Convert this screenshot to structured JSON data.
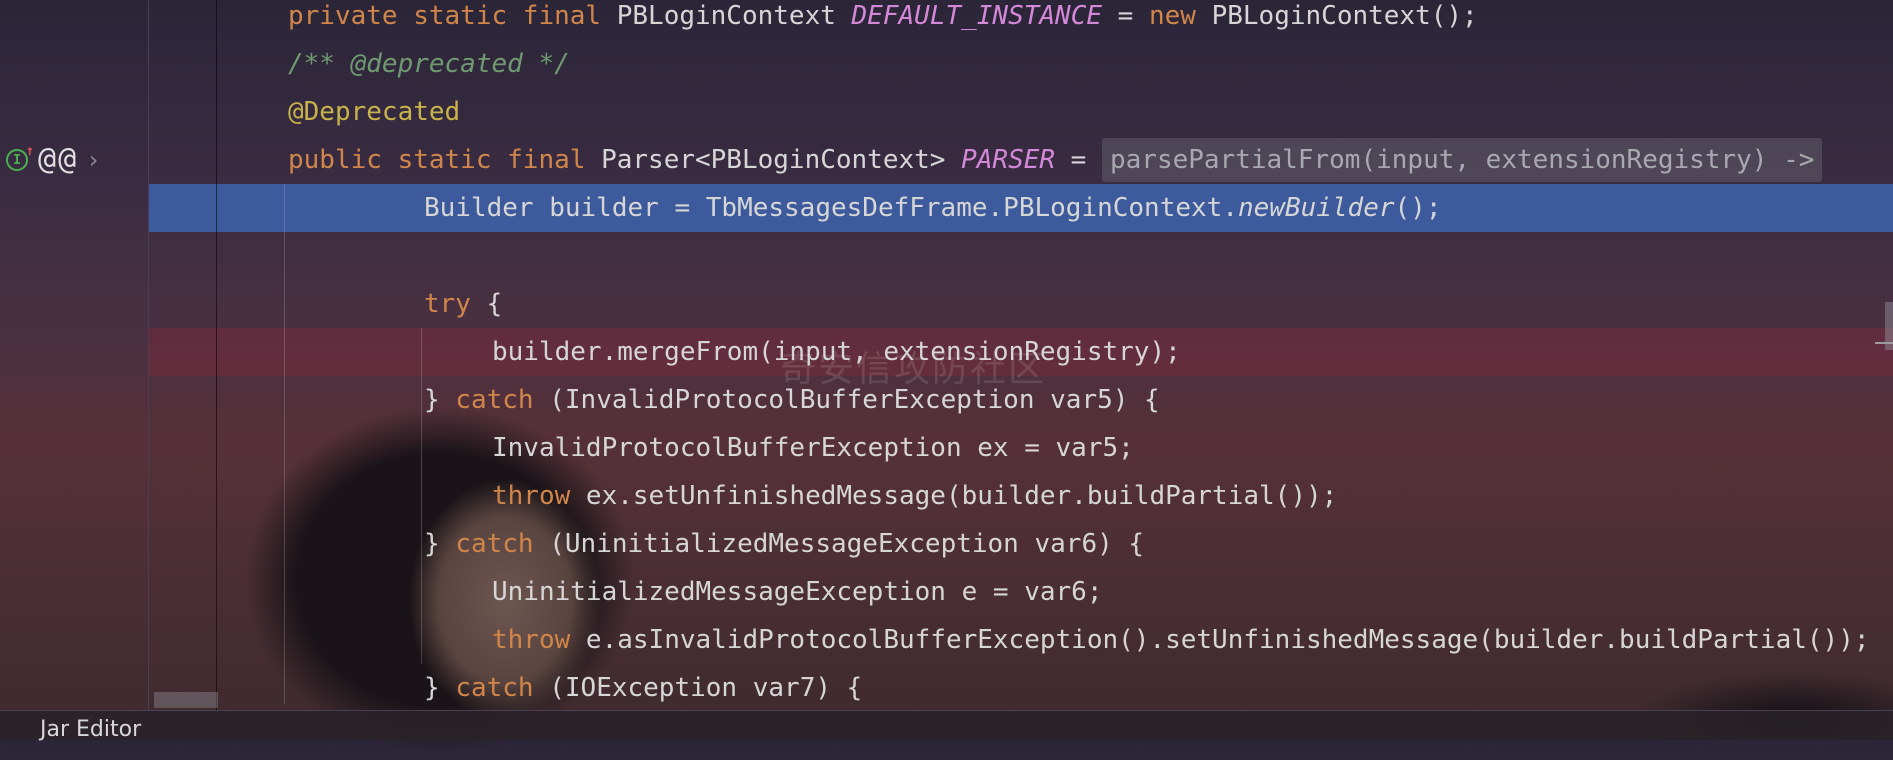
{
  "editor": {
    "lines": [
      {
        "segments": [
          {
            "t": "private static final ",
            "c": "kw"
          },
          {
            "t": "PBLoginContext ",
            "c": ""
          },
          {
            "t": "DEFAULT_INSTANCE",
            "c": "fn-italic"
          },
          {
            "t": " = ",
            "c": ""
          },
          {
            "t": "new ",
            "c": "kw"
          },
          {
            "t": "PBLoginContext();",
            "c": ""
          }
        ]
      },
      {
        "segments": [
          {
            "t": "/** @deprecated */",
            "c": "comment"
          }
        ]
      },
      {
        "segments": [
          {
            "t": "@Deprecated",
            "c": "anno"
          }
        ]
      },
      {
        "segments": [
          {
            "t": "public static final ",
            "c": "kw"
          },
          {
            "t": "Parser<PBLoginContext> ",
            "c": ""
          },
          {
            "t": "PARSER",
            "c": "fn-italic"
          },
          {
            "t": " = ",
            "c": ""
          }
        ],
        "hint": "parsePartialFrom(input, extensionRegistry) ->"
      },
      {
        "segments": [
          {
            "t": "Builder builder = TbMessagesDefFrame.PBLoginContext.",
            "c": ""
          },
          {
            "t": "newBuilder",
            "c": "ital"
          },
          {
            "t": "();",
            "c": ""
          }
        ]
      },
      {
        "segments": []
      },
      {
        "segments": [
          {
            "t": "try ",
            "c": "kw"
          },
          {
            "t": "{",
            "c": ""
          }
        ]
      },
      {
        "segments": [
          {
            "t": "builder.mergeFrom(input, extensionRegistry);",
            "c": ""
          }
        ]
      },
      {
        "segments": [
          {
            "t": "} ",
            "c": ""
          },
          {
            "t": "catch ",
            "c": "kw"
          },
          {
            "t": "(InvalidProtocolBufferException var5) {",
            "c": ""
          }
        ]
      },
      {
        "segments": [
          {
            "t": "InvalidProtocolBufferException ex = var5;",
            "c": ""
          }
        ]
      },
      {
        "segments": [
          {
            "t": "throw ",
            "c": "kw"
          },
          {
            "t": "ex.setUnfinishedMessage(builder.buildPartial());",
            "c": ""
          }
        ]
      },
      {
        "segments": [
          {
            "t": "} ",
            "c": ""
          },
          {
            "t": "catch ",
            "c": "kw"
          },
          {
            "t": "(UninitializedMessageException var6) {",
            "c": ""
          }
        ]
      },
      {
        "segments": [
          {
            "t": "UninitializedMessageException e = var6;",
            "c": ""
          }
        ]
      },
      {
        "segments": [
          {
            "t": "throw ",
            "c": "kw"
          },
          {
            "t": "e.asInvalidProtocolBufferException().setUnfinishedMessage(builder.buildPartial());",
            "c": ""
          }
        ]
      },
      {
        "segments": [
          {
            "t": "} ",
            "c": ""
          },
          {
            "t": "catch ",
            "c": "kw"
          },
          {
            "t": "(IOException var7) {",
            "c": ""
          }
        ]
      }
    ]
  },
  "status": {
    "label": "Jar Editor"
  },
  "watermark": "奇安信攻防社区",
  "icons": [
    "implements-icon",
    "annotation-icon",
    "annotation-icon",
    "chevron-right-icon"
  ]
}
